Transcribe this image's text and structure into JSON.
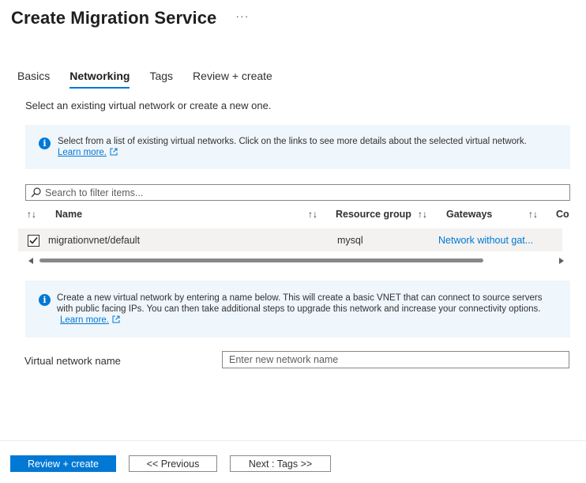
{
  "page": {
    "title": "Create Migration Service",
    "more_label": "···"
  },
  "tabs": [
    {
      "label": "Basics",
      "active": false
    },
    {
      "label": "Networking",
      "active": true
    },
    {
      "label": "Tags",
      "active": false
    },
    {
      "label": "Review + create",
      "active": false
    }
  ],
  "intro_text": "Select an existing virtual network or create a new one.",
  "info_existing": {
    "text": "Select from a list of existing virtual networks. Click on the links to see more details about the selected virtual network.",
    "link": "Learn more."
  },
  "search": {
    "placeholder": "Search to filter items..."
  },
  "grid": {
    "columns": [
      "Name",
      "Resource group",
      "Gateways",
      "Co"
    ],
    "sort_glyph": "↑↓",
    "rows": [
      {
        "checked": true,
        "name": "migrationvnet/default",
        "resource_group": "mysql",
        "gateways": "Network without gat..."
      }
    ]
  },
  "info_new": {
    "text": "Create a new virtual network by entering a name below. This will create a basic VNET that can connect to source servers with public facing IPs. You can then take additional steps to upgrade this network and increase your connectivity options.",
    "link": "Learn more."
  },
  "vnet_name": {
    "label": "Virtual network name",
    "placeholder": "Enter new network name",
    "value": ""
  },
  "footer": {
    "review_create": "Review + create",
    "previous": "<< Previous",
    "next": "Next : Tags >>"
  },
  "colors": {
    "accent": "#0078d4",
    "info_background": "#eff6fc",
    "row_selected": "#f3f2f1"
  },
  "icons": [
    "more-icon",
    "info-icon",
    "external-link-icon",
    "search-icon",
    "sort-icon",
    "checkbox-checked-icon",
    "scroll-left-arrow-icon",
    "scroll-right-arrow-icon"
  ]
}
